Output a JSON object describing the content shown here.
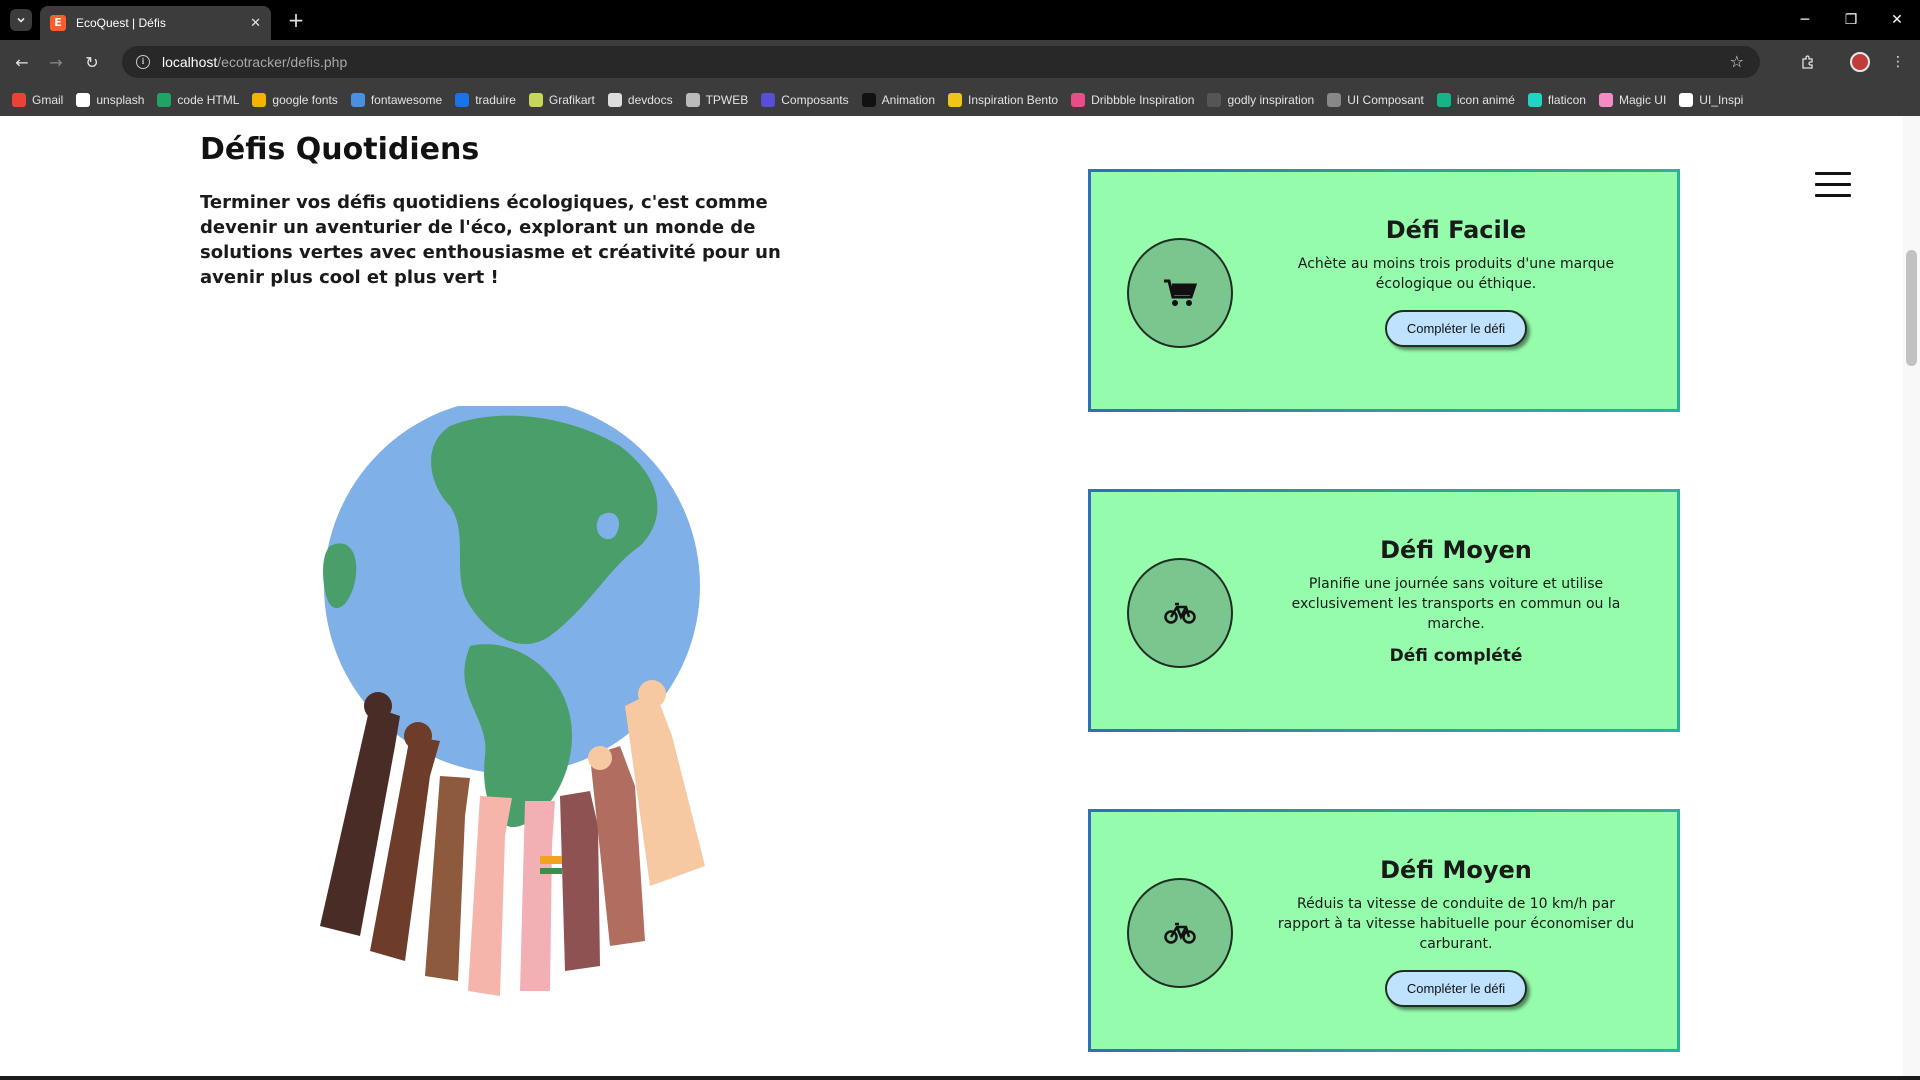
{
  "browser": {
    "tab_title": "EcoQuest | Défis",
    "tab_favicon": "E",
    "url_host": "localhost",
    "url_path": "/ecotracker/defis.php",
    "bookmarks": [
      {
        "label": "Gmail",
        "icon": "gmail-icon",
        "color": "#ea4335"
      },
      {
        "label": "unsplash",
        "icon": "unsplash-icon",
        "color": "#ffffff"
      },
      {
        "label": "code HTML",
        "icon": "code-html-icon",
        "color": "#1fa463"
      },
      {
        "label": "google fonts",
        "icon": "google-fonts-icon",
        "color": "#f4b400"
      },
      {
        "label": "fontawesome",
        "icon": "fontawesome-flag-icon",
        "color": "#4a90e2"
      },
      {
        "label": "traduire",
        "icon": "translate-icon",
        "color": "#1a73e8"
      },
      {
        "label": "Grafikart",
        "icon": "grafikart-icon",
        "color": "#c7d65a"
      },
      {
        "label": "devdocs",
        "icon": "devdocs-icon",
        "color": "#dddddd"
      },
      {
        "label": "TPWEB",
        "icon": "tpweb-icon",
        "color": "#bbbbbb"
      },
      {
        "label": "Composants",
        "icon": "composants-icon",
        "color": "#5b4dd6"
      },
      {
        "label": "Animation",
        "icon": "animation-icon",
        "color": "#111111"
      },
      {
        "label": "Inspiration Bento",
        "icon": "bento-icon",
        "color": "#f0c419"
      },
      {
        "label": "Dribbble Inspiration",
        "icon": "dribbble-icon",
        "color": "#ea4c89"
      },
      {
        "label": "godly inspiration",
        "icon": "godly-icon",
        "color": "#555555"
      },
      {
        "label": "UI Composant",
        "icon": "globe-icon",
        "color": "#888888"
      },
      {
        "label": "icon animé",
        "icon": "icon-anime-icon",
        "color": "#15b58a"
      },
      {
        "label": "flaticon",
        "icon": "flaticon-icon",
        "color": "#21d4c4"
      },
      {
        "label": "Magic UI",
        "icon": "magic-ui-icon",
        "color": "#f58ac4"
      },
      {
        "label": "UI_Inspi",
        "icon": "ui-inspi-icon",
        "color": "#ffffff"
      }
    ]
  },
  "page": {
    "title": "Défis Quotidiens",
    "intro": "Terminer vos défis quotidiens écologiques, c'est comme devenir un aventurier de l'éco, explorant un monde de solutions vertes avec enthousiasme et créativité pour un avenir plus cool et plus vert !",
    "illustration": "globe-held-by-hands-illustration",
    "menu_icon": "hamburger-menu-icon"
  },
  "challenges": [
    {
      "title": "Défi Facile",
      "description": "Achète au moins trois produits d'une marque écologique ou éthique.",
      "icon": "shopping-cart-icon",
      "button_label": "Compléter le défi",
      "status": ""
    },
    {
      "title": "Défi Moyen",
      "description": "Planifie une journée sans voiture et utilise exclusivement les transports en commun ou la marche.",
      "icon": "bicycle-icon",
      "button_label": "",
      "status": "Défi complété"
    },
    {
      "title": "Défi Moyen",
      "description": "Réduis ta vitesse de conduite de 10 km/h par rapport à ta vitesse habituelle pour économiser du carburant.",
      "icon": "bicycle-icon",
      "button_label": "Compléter le défi",
      "status": ""
    }
  ],
  "colors": {
    "card_background": "#95fcab",
    "icon_circle": "#7bc58f",
    "button_background": "#bfe3ff",
    "globe_ocean": "#7fb0e8",
    "globe_land": "#4a9e6a"
  }
}
